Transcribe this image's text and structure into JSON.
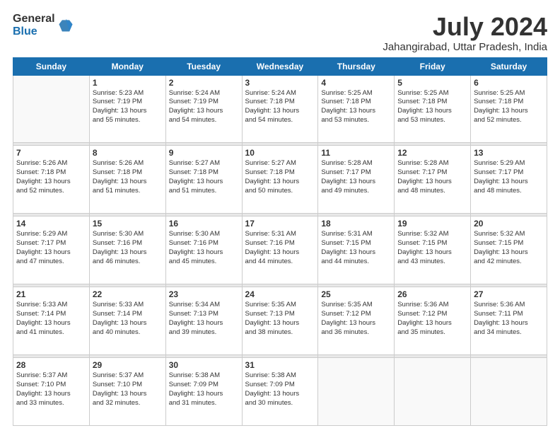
{
  "logo": {
    "general": "General",
    "blue": "Blue"
  },
  "title": "July 2024",
  "subtitle": "Jahangirabad, Uttar Pradesh, India",
  "weekdays": [
    "Sunday",
    "Monday",
    "Tuesday",
    "Wednesday",
    "Thursday",
    "Friday",
    "Saturday"
  ],
  "weeks": [
    [
      {
        "day": "",
        "info": ""
      },
      {
        "day": "1",
        "info": "Sunrise: 5:23 AM\nSunset: 7:19 PM\nDaylight: 13 hours\nand 55 minutes."
      },
      {
        "day": "2",
        "info": "Sunrise: 5:24 AM\nSunset: 7:19 PM\nDaylight: 13 hours\nand 54 minutes."
      },
      {
        "day": "3",
        "info": "Sunrise: 5:24 AM\nSunset: 7:18 PM\nDaylight: 13 hours\nand 54 minutes."
      },
      {
        "day": "4",
        "info": "Sunrise: 5:25 AM\nSunset: 7:18 PM\nDaylight: 13 hours\nand 53 minutes."
      },
      {
        "day": "5",
        "info": "Sunrise: 5:25 AM\nSunset: 7:18 PM\nDaylight: 13 hours\nand 53 minutes."
      },
      {
        "day": "6",
        "info": "Sunrise: 5:25 AM\nSunset: 7:18 PM\nDaylight: 13 hours\nand 52 minutes."
      }
    ],
    [
      {
        "day": "7",
        "info": "Sunrise: 5:26 AM\nSunset: 7:18 PM\nDaylight: 13 hours\nand 52 minutes."
      },
      {
        "day": "8",
        "info": "Sunrise: 5:26 AM\nSunset: 7:18 PM\nDaylight: 13 hours\nand 51 minutes."
      },
      {
        "day": "9",
        "info": "Sunrise: 5:27 AM\nSunset: 7:18 PM\nDaylight: 13 hours\nand 51 minutes."
      },
      {
        "day": "10",
        "info": "Sunrise: 5:27 AM\nSunset: 7:18 PM\nDaylight: 13 hours\nand 50 minutes."
      },
      {
        "day": "11",
        "info": "Sunrise: 5:28 AM\nSunset: 7:17 PM\nDaylight: 13 hours\nand 49 minutes."
      },
      {
        "day": "12",
        "info": "Sunrise: 5:28 AM\nSunset: 7:17 PM\nDaylight: 13 hours\nand 48 minutes."
      },
      {
        "day": "13",
        "info": "Sunrise: 5:29 AM\nSunset: 7:17 PM\nDaylight: 13 hours\nand 48 minutes."
      }
    ],
    [
      {
        "day": "14",
        "info": "Sunrise: 5:29 AM\nSunset: 7:17 PM\nDaylight: 13 hours\nand 47 minutes."
      },
      {
        "day": "15",
        "info": "Sunrise: 5:30 AM\nSunset: 7:16 PM\nDaylight: 13 hours\nand 46 minutes."
      },
      {
        "day": "16",
        "info": "Sunrise: 5:30 AM\nSunset: 7:16 PM\nDaylight: 13 hours\nand 45 minutes."
      },
      {
        "day": "17",
        "info": "Sunrise: 5:31 AM\nSunset: 7:16 PM\nDaylight: 13 hours\nand 44 minutes."
      },
      {
        "day": "18",
        "info": "Sunrise: 5:31 AM\nSunset: 7:15 PM\nDaylight: 13 hours\nand 44 minutes."
      },
      {
        "day": "19",
        "info": "Sunrise: 5:32 AM\nSunset: 7:15 PM\nDaylight: 13 hours\nand 43 minutes."
      },
      {
        "day": "20",
        "info": "Sunrise: 5:32 AM\nSunset: 7:15 PM\nDaylight: 13 hours\nand 42 minutes."
      }
    ],
    [
      {
        "day": "21",
        "info": "Sunrise: 5:33 AM\nSunset: 7:14 PM\nDaylight: 13 hours\nand 41 minutes."
      },
      {
        "day": "22",
        "info": "Sunrise: 5:33 AM\nSunset: 7:14 PM\nDaylight: 13 hours\nand 40 minutes."
      },
      {
        "day": "23",
        "info": "Sunrise: 5:34 AM\nSunset: 7:13 PM\nDaylight: 13 hours\nand 39 minutes."
      },
      {
        "day": "24",
        "info": "Sunrise: 5:35 AM\nSunset: 7:13 PM\nDaylight: 13 hours\nand 38 minutes."
      },
      {
        "day": "25",
        "info": "Sunrise: 5:35 AM\nSunset: 7:12 PM\nDaylight: 13 hours\nand 36 minutes."
      },
      {
        "day": "26",
        "info": "Sunrise: 5:36 AM\nSunset: 7:12 PM\nDaylight: 13 hours\nand 35 minutes."
      },
      {
        "day": "27",
        "info": "Sunrise: 5:36 AM\nSunset: 7:11 PM\nDaylight: 13 hours\nand 34 minutes."
      }
    ],
    [
      {
        "day": "28",
        "info": "Sunrise: 5:37 AM\nSunset: 7:10 PM\nDaylight: 13 hours\nand 33 minutes."
      },
      {
        "day": "29",
        "info": "Sunrise: 5:37 AM\nSunset: 7:10 PM\nDaylight: 13 hours\nand 32 minutes."
      },
      {
        "day": "30",
        "info": "Sunrise: 5:38 AM\nSunset: 7:09 PM\nDaylight: 13 hours\nand 31 minutes."
      },
      {
        "day": "31",
        "info": "Sunrise: 5:38 AM\nSunset: 7:09 PM\nDaylight: 13 hours\nand 30 minutes."
      },
      {
        "day": "",
        "info": ""
      },
      {
        "day": "",
        "info": ""
      },
      {
        "day": "",
        "info": ""
      }
    ]
  ]
}
